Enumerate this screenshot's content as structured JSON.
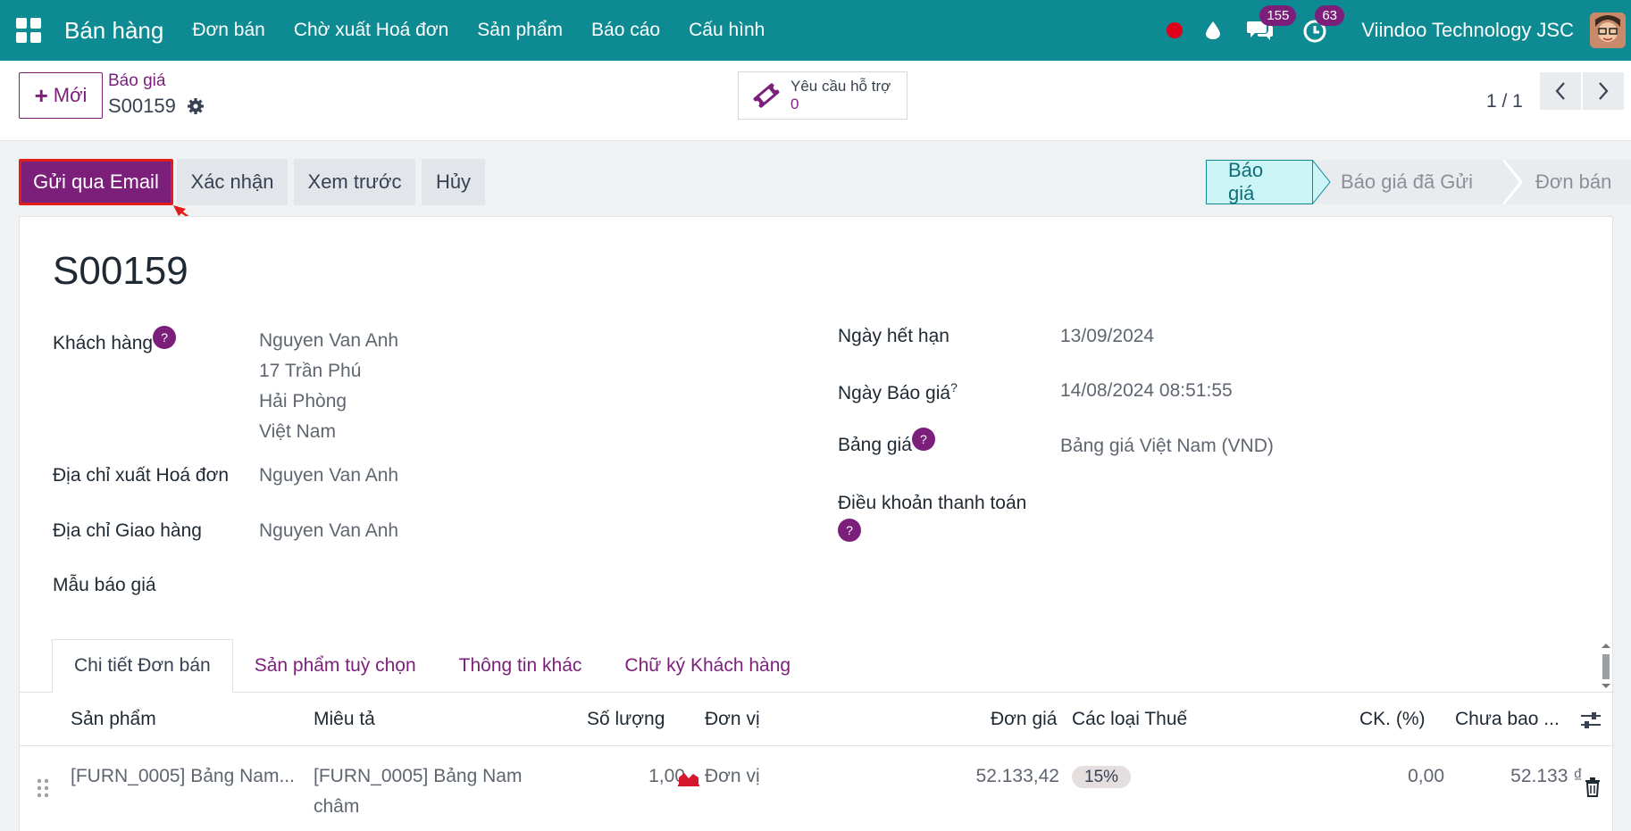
{
  "navbar": {
    "brand": "Bán hàng",
    "menu": [
      "Đơn bán",
      "Chờ xuất Hoá đơn",
      "Sản phẩm",
      "Báo cáo",
      "Cấu hình"
    ],
    "messages_count": "155",
    "activities_count": "63",
    "company": "Viindoo Technology JSC"
  },
  "control": {
    "new_label": "Mới",
    "breadcrumb": "Báo giá",
    "record": "S00159",
    "support_label": "Yêu cầu hỗ trợ",
    "support_count": "0",
    "pager": "1 / 1"
  },
  "actions": {
    "send_email": "Gửi qua Email",
    "confirm": "Xác nhận",
    "preview": "Xem trước",
    "cancel": "Hủy"
  },
  "stages": {
    "s1": "Báo giá",
    "s2": "Báo giá đã Gửi",
    "s3": "Đơn bán"
  },
  "form": {
    "title": "S00159",
    "customer_label": "Khách hàng",
    "customer_lines": [
      "Nguyen Van Anh",
      "17 Trần Phú",
      "Hải Phòng",
      "Việt Nam"
    ],
    "invoice_addr_label": "Địa chỉ xuất Hoá đơn",
    "invoice_addr": "Nguyen Van Anh",
    "delivery_addr_label": "Địa chỉ Giao hàng",
    "delivery_addr": "Nguyen Van Anh",
    "template_label": "Mẫu báo giá",
    "expiry_label": "Ngày hết hạn",
    "expiry": "13/09/2024",
    "quote_date_label": "Ngày Báo giá",
    "quote_date": "14/08/2024 08:51:55",
    "pricelist_label": "Bảng giá",
    "pricelist": "Bảng giá Việt Nam (VND)",
    "payment_terms_label": "Điều khoản thanh toán",
    "help_mark": "?"
  },
  "tabs": [
    "Chi tiết Đơn bán",
    "Sản phẩm tuỳ chọn",
    "Thông tin khác",
    "Chữ ký Khách hàng"
  ],
  "table": {
    "headers": [
      "Sản phẩm",
      "Miêu tả",
      "Số lượng",
      "Đơn vị",
      "Đơn giá",
      "Các loại Thuế",
      "CK. (%)",
      "Chưa bao ..."
    ],
    "rows": [
      {
        "product": "[FURN_0005] Bảng Nam...",
        "desc_1": "[FURN_0005] Bảng Nam",
        "desc_2": "châm",
        "qty": "1,00",
        "uom": "Đơn vị",
        "price": "52.133,42",
        "tax": "15%",
        "discount": "0,00",
        "subtotal": "52.133 ₫"
      }
    ]
  },
  "colors": {
    "navbar": "#0e8a93",
    "primary": "#7b1f7b",
    "highlight": "#e21b1b"
  }
}
